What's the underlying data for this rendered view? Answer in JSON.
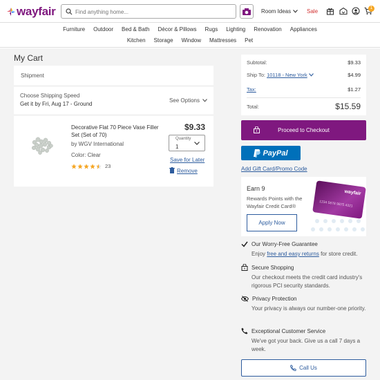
{
  "header": {
    "logo": "wayfair",
    "search_placeholder": "Find anything home...",
    "room_ideas": "Room Ideas",
    "sale": "Sale",
    "cart_count": "1",
    "brand_color": "#7f187f"
  },
  "nav": {
    "row1": [
      "Furniture",
      "Outdoor",
      "Bed & Bath",
      "Décor & Pillows",
      "Rugs",
      "Lighting",
      "Renovation",
      "Appliances"
    ],
    "row2": [
      "Kitchen",
      "Storage",
      "Window",
      "Mattresses",
      "Pet"
    ]
  },
  "cart": {
    "title": "My Cart",
    "shipment_label": "Shipment",
    "shipping_speed_label": "Choose Shipping Speed",
    "shipping_eta": "Get it by Fri, Aug 17 - Ground",
    "see_options": "See Options",
    "item": {
      "name": "Decorative Flat 70 Piece Vase Filler Set (Set of 70)",
      "brand": "by WGV International",
      "color": "Color: Clear",
      "rating": 4.5,
      "reviews": "23",
      "price": "$9.33",
      "quantity_label": "Quantity",
      "quantity": "1",
      "save_for_later": "Save for Later",
      "remove": "Remove"
    }
  },
  "summary": {
    "subtotal_label": "Subtotal:",
    "subtotal": "$9.33",
    "ship_to_label": "Ship To:",
    "ship_to_value": "10118 - New York",
    "ship_to_amount": "$4.99",
    "tax_label": "Tax:",
    "tax": "$1.27",
    "total_label": "Total:",
    "total": "$15.59",
    "checkout": "Proceed to Checkout",
    "paypal": "PayPal",
    "gift": "Add Gift Card/Promo Code"
  },
  "credit": {
    "earn": "Earn 9",
    "rewards": "Rewards Points with the Wayfair Credit Card®",
    "apply": "Apply Now",
    "card_logo": "wayfair",
    "card_number": "1234 5678 9875 4321"
  },
  "features": [
    {
      "title": "Our Worry-Free Guarantee",
      "body_pre": "Enjoy ",
      "link": "free and easy returns",
      "body_post": " for store credit."
    },
    {
      "title": "Secure Shopping",
      "body": "Our checkout meets the credit card industry's rigorous PCI security standards."
    },
    {
      "title": "Privacy Protection",
      "body": "Your privacy is always our number-one priority."
    },
    {
      "title": "Exceptional Customer Service",
      "body": "We've got your back. Give us a call 7 days a week."
    }
  ],
  "call_us": "Call Us"
}
